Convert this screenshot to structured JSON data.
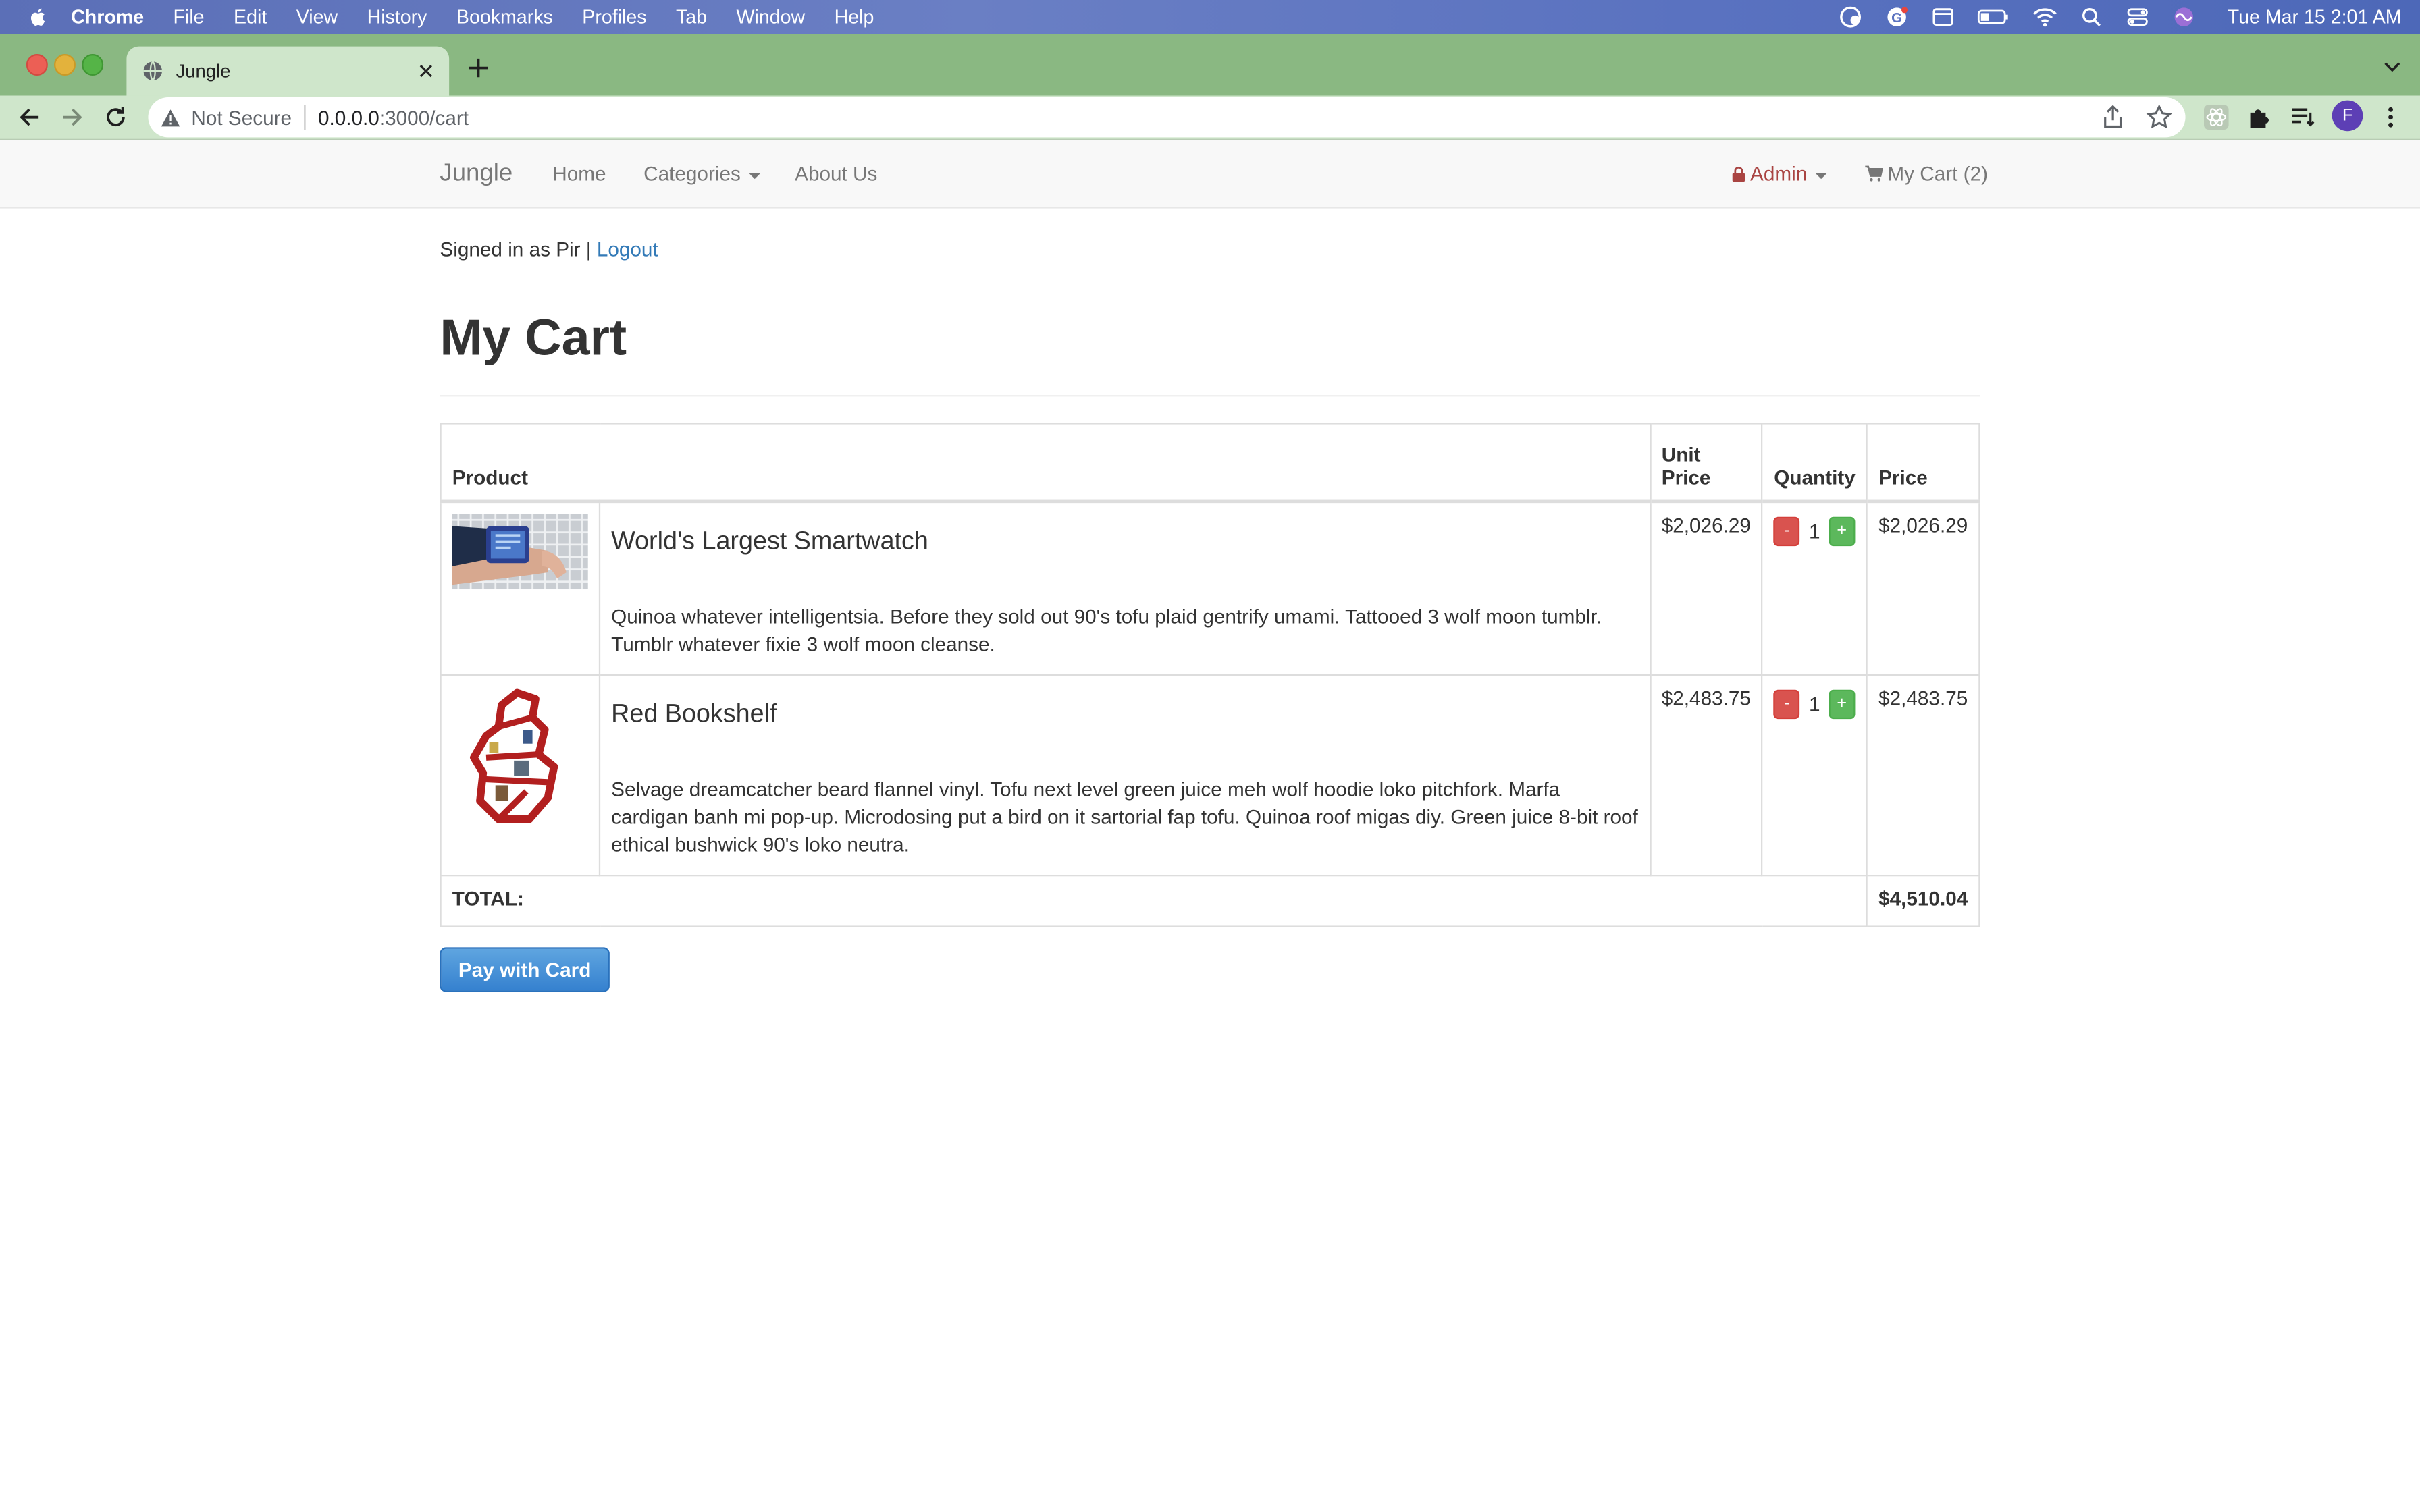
{
  "menubar": {
    "app_name": "Chrome",
    "items": [
      "File",
      "Edit",
      "View",
      "History",
      "Bookmarks",
      "Profiles",
      "Tab",
      "Window",
      "Help"
    ],
    "clock": "Tue Mar 15  2:01 AM"
  },
  "browser": {
    "tab_title": "Jungle",
    "security_label": "Not Secure",
    "url_host": "0.0.0.0",
    "url_path": ":3000/cart",
    "profile_initial": "F"
  },
  "site": {
    "brand": "Jungle",
    "nav": {
      "home": "Home",
      "categories": "Categories",
      "about": "About Us",
      "admin": "Admin",
      "cart": "My Cart (2)"
    }
  },
  "session": {
    "signed_in_text": "Signed in as Pir |",
    "logout": "Logout"
  },
  "page": {
    "title": "My Cart"
  },
  "table": {
    "headers": {
      "product": "Product",
      "unit_price": "Unit Price",
      "quantity": "Quantity",
      "price": "Price"
    },
    "items": [
      {
        "name": "World's Largest Smartwatch",
        "description": "Quinoa whatever intelligentsia. Before they sold out 90's tofu plaid gentrify umami. Tattooed 3 wolf moon tumblr. Tumblr whatever fixie 3 wolf moon cleanse.",
        "unit_price": "$2,026.29",
        "quantity": "1",
        "price": "$2,026.29"
      },
      {
        "name": "Red Bookshelf",
        "description": "Selvage dreamcatcher beard flannel vinyl. Tofu next level green juice meh wolf hoodie loko pitchfork. Marfa cardigan banh mi pop-up. Microdosing put a bird on it sartorial fap tofu. Quinoa roof migas diy. Green juice 8-bit roof ethical bushwick 90's loko neutra.",
        "unit_price": "$2,483.75",
        "quantity": "1",
        "price": "$2,483.75"
      }
    ],
    "minus": "-",
    "plus": "+",
    "total_label": "TOTAL:",
    "total_value": "$4,510.04"
  },
  "checkout": {
    "pay_button": "Pay with Card"
  },
  "colors": {
    "link": "#337ab7",
    "admin": "#a94442",
    "danger": "#d9534f",
    "success": "#5cb85c",
    "primary": "#3581cf",
    "tabstrip": "#8ab882"
  }
}
